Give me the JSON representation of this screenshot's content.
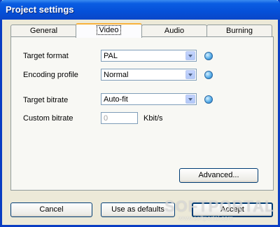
{
  "window": {
    "title": "Project settings"
  },
  "tabs": [
    {
      "label": "General"
    },
    {
      "label": "Video",
      "active": true
    },
    {
      "label": "Audio"
    },
    {
      "label": "Burning"
    }
  ],
  "video": {
    "target_format": {
      "label": "Target format",
      "value": "PAL"
    },
    "encoding_profile": {
      "label": "Encoding profile",
      "value": "Normal"
    },
    "target_bitrate": {
      "label": "Target bitrate",
      "value": "Auto-fit"
    },
    "custom_bitrate": {
      "label": "Custom bitrate",
      "value": "0",
      "unit": "Kbit/s",
      "disabled": true
    },
    "advanced_label": "Advanced..."
  },
  "footer": {
    "cancel_label": "Cancel",
    "defaults_label": "Use as defaults",
    "accept_label": "Accept"
  },
  "watermark": {
    "text": "SOFTPORTAL",
    "url": "www.softportal.com"
  },
  "colors": {
    "titlebar": "#0550d8",
    "frame": "#0a3dc2",
    "dialog_bg": "#ece9d8",
    "tab_highlight": "#f8b23c"
  },
  "icons": {
    "help": "info-icon",
    "dropdown": "chevron-down-icon"
  }
}
